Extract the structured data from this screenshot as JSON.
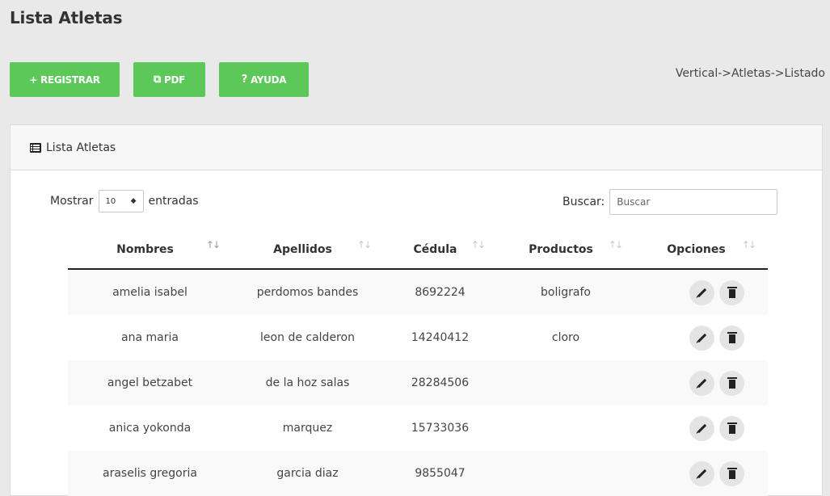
{
  "page": {
    "title": "Lista Atletas"
  },
  "toolbar": {
    "registrar_label": "+ REGISTRAR",
    "pdf_label": "PDF",
    "ayuda_icon_glyph": "?",
    "ayuda_label": "AYUDA"
  },
  "breadcrumb": "Vertical->Atletas->Listado",
  "panel": {
    "title": "Lista Atletas"
  },
  "length_control": {
    "prefix": "Mostrar",
    "value": "10",
    "suffix": "entradas"
  },
  "search": {
    "label": "Buscar:",
    "placeholder": "Buscar",
    "value": ""
  },
  "table": {
    "columns": [
      "Nombres",
      "Apellidos",
      "Cédula",
      "Productos",
      "Opciones"
    ],
    "sorted_column": "Nombres",
    "rows": [
      {
        "nombres": "amelia isabel",
        "apellidos": "perdomos bandes",
        "cedula": "8692224",
        "productos": "boligrafo"
      },
      {
        "nombres": "ana maria",
        "apellidos": "leon de calderon",
        "cedula": "14240412",
        "productos": "cloro"
      },
      {
        "nombres": "angel betzabet",
        "apellidos": "de la hoz salas",
        "cedula": "28284506",
        "productos": ""
      },
      {
        "nombres": "anica yokonda",
        "apellidos": "marquez",
        "cedula": "15733036",
        "productos": ""
      },
      {
        "nombres": "araselis gregoria",
        "apellidos": "garcia diaz",
        "cedula": "9855047",
        "productos": ""
      }
    ]
  },
  "colors": {
    "button_green": "#5cc85a",
    "page_bg": "#e9e9e9"
  },
  "icons": {
    "pdf": "copy-icon",
    "ayuda": "question-icon",
    "panel": "list-icon",
    "edit": "pencil-icon",
    "delete": "trash-icon",
    "sort": "sort-arrows-icon"
  }
}
